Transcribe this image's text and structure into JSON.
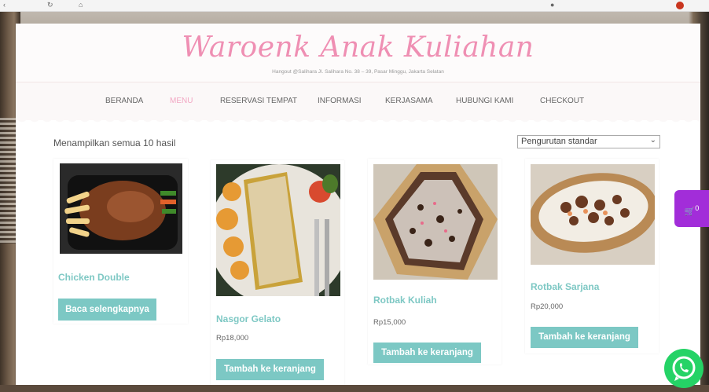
{
  "header": {
    "title": "Waroenk Anak Kuliahan",
    "tagline": "Hangout @Salihara Jl. Salihara No. 38 – 39, Pasar Minggu, Jakarta Selatan"
  },
  "nav": {
    "items": [
      "BERANDA",
      "MENU",
      "RESERVASI TEMPAT",
      "INFORMASI",
      "KERJASAMA",
      "HUBUNGI KAMI",
      "CHECKOUT"
    ],
    "active": "MENU"
  },
  "shop": {
    "result_count": "Menampilkan semua 10 hasil",
    "sort_selected": "Pengurutan standar"
  },
  "products": [
    {
      "name": "Chicken Double",
      "price": "",
      "button": "Baca selengkapnya",
      "image": "grilled-chicken-with-fries-photo"
    },
    {
      "name": "Nasgor Gelato",
      "price": "Rp18,000",
      "button": "Tambah ke keranjang",
      "image": "fried-rice-with-cheese-photo"
    },
    {
      "name": "Rotbak Kuliah",
      "price": "Rp15,000",
      "button": "Tambah ke keranjang",
      "image": "martabak-with-cheese-photo"
    },
    {
      "name": "Rotbak Sarjana",
      "price": "Rp20,000",
      "button": "Tambah ke keranjang",
      "image": "martabak-with-toppings-photo"
    }
  ],
  "cart_fab": {
    "count": "0",
    "icon": "cart-icon"
  },
  "whatsapp_fab": {
    "icon": "whatsapp-icon"
  },
  "colors": {
    "title_pink": "#ef8fb3",
    "accent_teal": "#7cc8c4",
    "cart_purple": "#a22dd9",
    "whatsapp_green": "#25d366"
  }
}
